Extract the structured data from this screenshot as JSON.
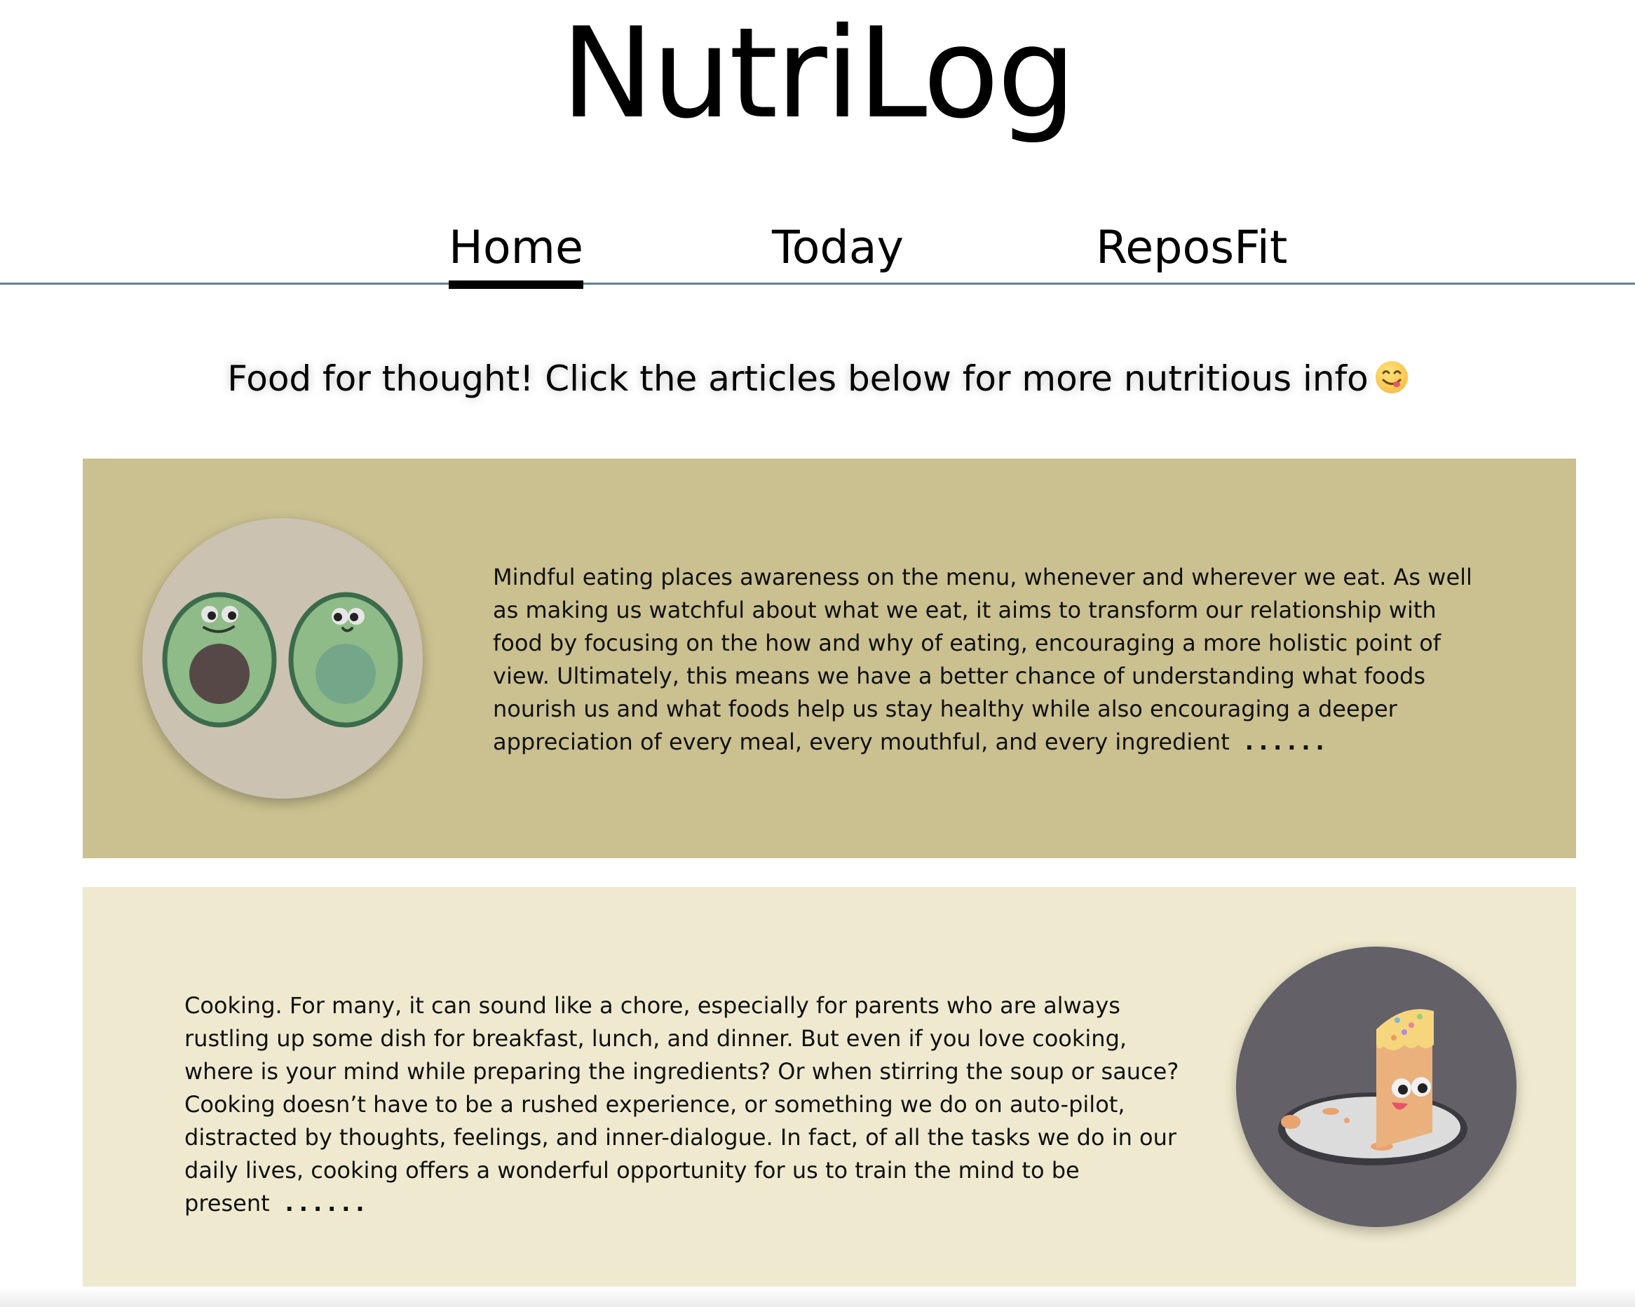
{
  "header": {
    "brand": "NutriLog"
  },
  "nav": {
    "items": [
      {
        "label": "Home",
        "active": true
      },
      {
        "label": "Today",
        "active": false
      },
      {
        "label": "ReposFit",
        "active": false
      }
    ],
    "underline_color": "#5f8294"
  },
  "tagline": {
    "text": "Food for thought! Click the articles below for more nutritious info",
    "emoji": "yum-face-emoji"
  },
  "articles": [
    {
      "image": "avocado-illustration",
      "background": "#cbc190",
      "excerpt": "Mindful eating places awareness on the menu, whenever and wherever we eat. As well as making us watchful about what we eat, it aims to transform our relationship with food by focusing on the how and why of eating, encouraging a more holistic point of view. Ultimately, this means we have a better chance of understanding what foods nourish us and what foods help us stay healthy while also encouraging a deeper appreciation of every meal, every mouthful, and every ingredient",
      "more": "......"
    },
    {
      "image": "cake-slice-illustration",
      "background": "#efeacf",
      "excerpt": "Cooking. For many, it can sound like a chore, especially for parents who are always rustling up some dish for breakfast, lunch, and dinner. But even if you love cooking, where is your mind while preparing the ingredients? Or when stirring the soup or sauce? Cooking doesn’t have to be a rushed experience, or something we do on auto-pilot, distracted by thoughts, feelings, and inner-dialogue. In fact, of all the tasks we do in our daily lives, cooking offers a wonderful opportunity for us to train the mind to be present",
      "more": "......"
    }
  ]
}
